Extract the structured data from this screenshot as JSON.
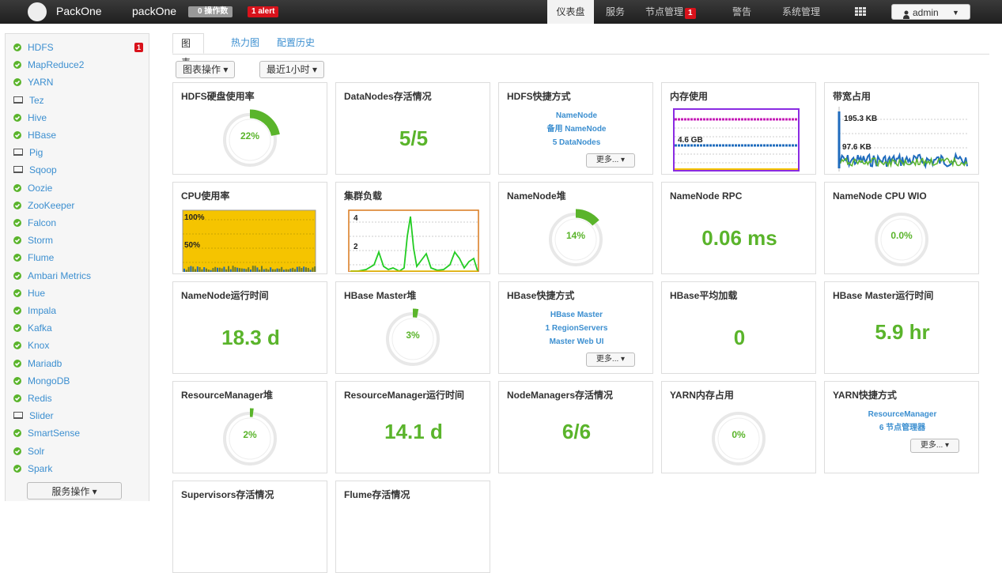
{
  "topbar": {
    "brand": "PackOne",
    "cluster": "packOne",
    "ops_badge": "0 操作数",
    "alert_badge": "1 alert",
    "nav": [
      {
        "label": "仪表盘",
        "active": true
      },
      {
        "label": "服务"
      },
      {
        "label": "节点管理",
        "badge": "1"
      },
      {
        "label": "警告"
      },
      {
        "label": "系统管理"
      }
    ],
    "user": "admin"
  },
  "sidebar": {
    "services": [
      {
        "name": "HDFS",
        "status": "ok",
        "alert": "1"
      },
      {
        "name": "MapReduce2",
        "status": "ok"
      },
      {
        "name": "YARN",
        "status": "ok"
      },
      {
        "name": "Tez",
        "status": "client"
      },
      {
        "name": "Hive",
        "status": "ok"
      },
      {
        "name": "HBase",
        "status": "ok"
      },
      {
        "name": "Pig",
        "status": "client"
      },
      {
        "name": "Sqoop",
        "status": "client"
      },
      {
        "name": "Oozie",
        "status": "ok"
      },
      {
        "name": "ZooKeeper",
        "status": "ok"
      },
      {
        "name": "Falcon",
        "status": "ok"
      },
      {
        "name": "Storm",
        "status": "ok"
      },
      {
        "name": "Flume",
        "status": "ok"
      },
      {
        "name": "Ambari Metrics",
        "status": "ok"
      },
      {
        "name": "Hue",
        "status": "ok"
      },
      {
        "name": "Impala",
        "status": "ok"
      },
      {
        "name": "Kafka",
        "status": "ok"
      },
      {
        "name": "Knox",
        "status": "ok"
      },
      {
        "name": "Mariadb",
        "status": "ok"
      },
      {
        "name": "MongoDB",
        "status": "ok"
      },
      {
        "name": "Redis",
        "status": "ok"
      },
      {
        "name": "Slider",
        "status": "client"
      },
      {
        "name": "SmartSense",
        "status": "ok"
      },
      {
        "name": "Solr",
        "status": "ok"
      },
      {
        "name": "Spark",
        "status": "ok"
      }
    ],
    "actions_label": "服务操作 ▾"
  },
  "tabs": [
    "图表",
    "热力图",
    "配置历史"
  ],
  "toolbar": {
    "chart_actions": "图表操作 ▾",
    "time_range": "最近1小时 ▾"
  },
  "widgets": [
    {
      "title": "HDFS硬盘使用率",
      "kind": "ring",
      "pct": "22%",
      "fill": 0.22
    },
    {
      "title": "DataNodes存活情况",
      "kind": "big",
      "value": "5/5"
    },
    {
      "title": "HDFS快捷方式",
      "kind": "links",
      "links": [
        "NameNode",
        "备用 NameNode",
        "5 DataNodes"
      ],
      "more": "更多... ▾"
    },
    {
      "title": "内存使用",
      "kind": "chart",
      "chart": "mem"
    },
    {
      "title": "带宽占用",
      "kind": "chart",
      "chart": "bw"
    },
    {
      "title": "CPU使用率",
      "kind": "chart",
      "chart": "cpu"
    },
    {
      "title": "集群负载",
      "kind": "chart",
      "chart": "load"
    },
    {
      "title": "NameNode堆",
      "kind": "ring",
      "pct": "14%",
      "fill": 0.14
    },
    {
      "title": "NameNode RPC",
      "kind": "big",
      "value": "0.06 ms"
    },
    {
      "title": "NameNode CPU WIO",
      "kind": "ring",
      "pct": "0.0%",
      "fill": 0
    },
    {
      "title": "NameNode运行时间",
      "kind": "big",
      "value": "18.3 d"
    },
    {
      "title": "HBase Master堆",
      "kind": "ring",
      "pct": "3%",
      "fill": 0.03
    },
    {
      "title": "HBase快捷方式",
      "kind": "links",
      "links": [
        "HBase Master",
        "1 RegionServers",
        "Master Web UI"
      ],
      "more": "更多... ▾"
    },
    {
      "title": "HBase平均加载",
      "kind": "big",
      "value": "0"
    },
    {
      "title": "HBase Master运行时间",
      "kind": "big",
      "value": "5.9 hr"
    },
    {
      "title": "ResourceManager堆",
      "kind": "ring",
      "pct": "2%",
      "fill": 0.02
    },
    {
      "title": "ResourceManager运行时间",
      "kind": "big",
      "value": "14.1 d"
    },
    {
      "title": "NodeManagers存活情况",
      "kind": "big",
      "value": "6/6"
    },
    {
      "title": "YARN内存占用",
      "kind": "ring",
      "pct": "0%",
      "fill": 0
    },
    {
      "title": "YARN快捷方式",
      "kind": "links",
      "links": [
        "ResourceManager",
        "6 节点管理器"
      ],
      "more": "更多... ▾"
    },
    {
      "title": "Supervisors存活情况",
      "kind": "partial"
    },
    {
      "title": "Flume存活情况",
      "kind": "partial"
    }
  ],
  "chart_labels": {
    "mem": [
      "4.6 GB"
    ],
    "bw": [
      "195.3 KB",
      "97.6 KB"
    ],
    "cpu": [
      "100%",
      "50%"
    ],
    "load": [
      "4",
      "2"
    ]
  },
  "colors": {
    "green": "#5ab42b",
    "link": "#3c8fd0",
    "alert": "#d9121b"
  }
}
